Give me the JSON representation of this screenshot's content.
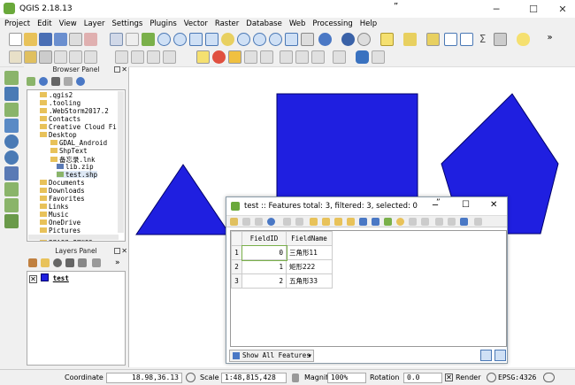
{
  "window": {
    "title": "QGIS 2.18.13",
    "marker": "”"
  },
  "menu": [
    "Project",
    "Edit",
    "View",
    "Layer",
    "Settings",
    "Plugins",
    "Vector",
    "Raster",
    "Database",
    "Web",
    "Processing",
    "Help"
  ],
  "browser_panel": {
    "title": "Browser Panel",
    "items": [
      ".qgis2",
      ".tooling",
      ".WebStorm2017.2",
      "Contacts",
      "Creative Cloud Fi",
      "Desktop",
      "GDAL_Android",
      "ShpText",
      "备忘录.lnk",
      "lib.zip",
      "test.shp",
      "Documents",
      "Downloads",
      "Favorites",
      "Links",
      "Music",
      "OneDrive",
      "Pictures",
      "Saved Games"
    ]
  },
  "layers_panel": {
    "title": "Layers Panel",
    "layer": "test"
  },
  "attribute_table": {
    "title": "test :: Features total: 3, filtered: 3, selected: 0",
    "marker": "”",
    "columns": [
      "FieldID",
      "FieldName"
    ],
    "rows": [
      {
        "n": "1",
        "id": "0",
        "name": "三角形11"
      },
      {
        "n": "2",
        "id": "1",
        "name": "矩形222"
      },
      {
        "n": "3",
        "id": "2",
        "name": "五角形33"
      }
    ],
    "filter_button": "Show All Features"
  },
  "status": {
    "coordinate_label": "Coordinate",
    "coordinate": "18.98,36.13",
    "scale_label": "Scale",
    "scale": "1:48,815,428",
    "magnifier_label": "Magnifier",
    "magnifier": "100%",
    "rotation_label": "Rotation",
    "rotation": "0.0",
    "render_label": "Render",
    "crs": "EPSG:4326"
  },
  "colors": {
    "feature_fill": "#1f1fe0",
    "feature_stroke": "#00006a"
  }
}
